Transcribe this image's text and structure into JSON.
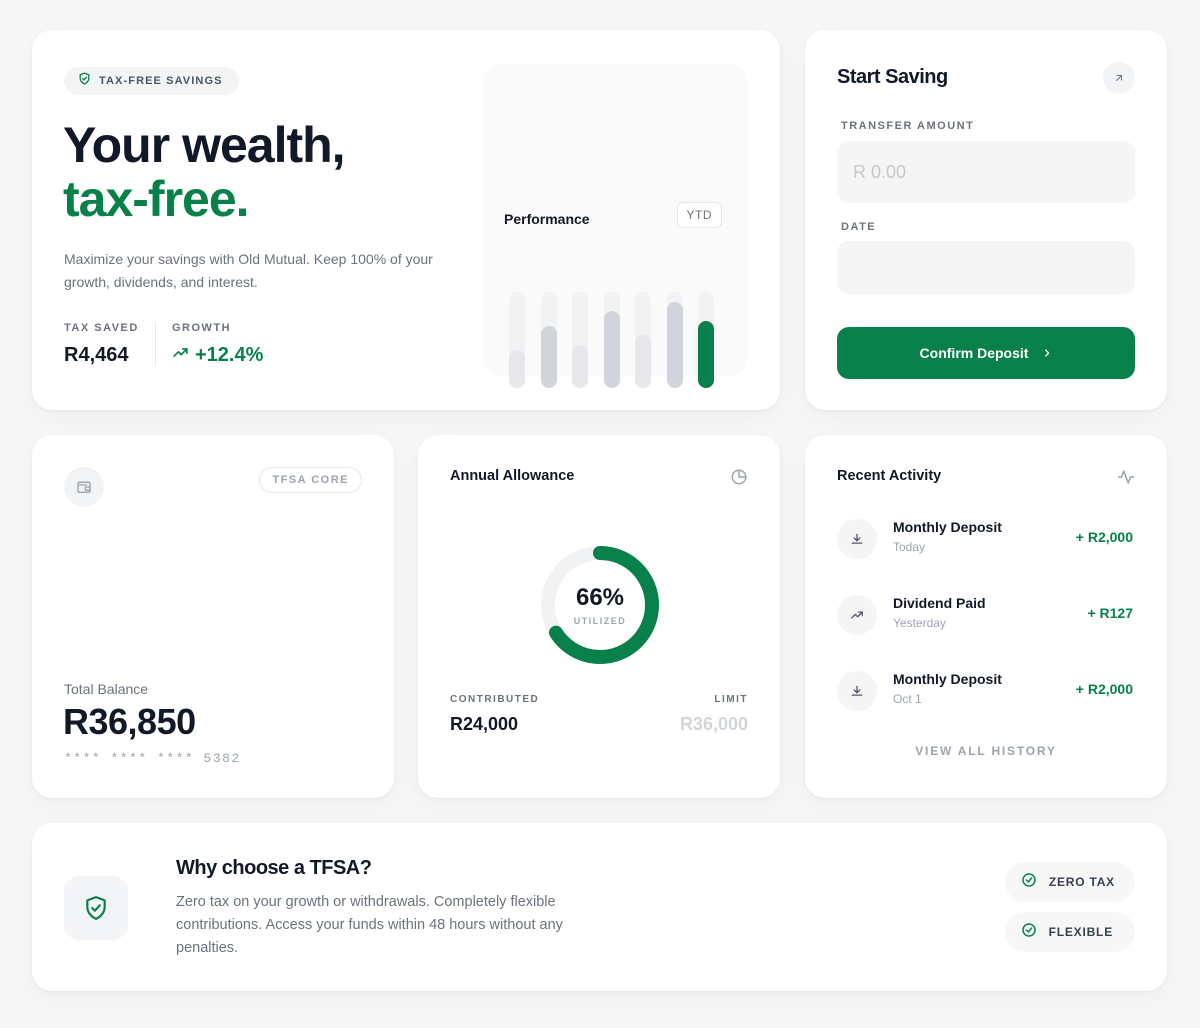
{
  "hero": {
    "badge": "TAX-FREE SAVINGS",
    "title_line1": "Your wealth,",
    "title_line2": "tax-free.",
    "description": "Maximize your savings with Old Mutual. Keep 100% of your growth, dividends, and interest.",
    "stats": {
      "tax_saved_label": "TAX SAVED",
      "tax_saved_value": "R4,464",
      "growth_label": "GROWTH",
      "growth_value": "+12.4%"
    },
    "performance": {
      "title": "Performance",
      "period": "YTD",
      "bar_levels": [
        0.4,
        0.65,
        0.45,
        0.8,
        0.55,
        0.9,
        0.7
      ],
      "highlight_index": 6
    }
  },
  "saving": {
    "title": "Start Saving",
    "amount_label": "TRANSFER AMOUNT",
    "amount_placeholder": "R 0.00",
    "date_label": "DATE",
    "date_value": "",
    "confirm_label": "Confirm Deposit"
  },
  "balance": {
    "badge": "TFSA CORE",
    "label": "Total Balance",
    "value": "R36,850",
    "card_number": "**** **** **** 5382"
  },
  "allowance": {
    "title": "Annual Allowance",
    "percent_text": "66%",
    "percent_value": 0.66,
    "utilized_label": "UTILIZED",
    "contributed_label": "CONTRIBUTED",
    "contributed_value": "R24,000",
    "limit_label": "LIMIT",
    "limit_value": "R36,000"
  },
  "activity": {
    "title": "Recent Activity",
    "items": [
      {
        "title": "Monthly Deposit",
        "date": "Today",
        "amount": "+ R2,000",
        "icon": "download-icon"
      },
      {
        "title": "Dividend Paid",
        "date": "Yesterday",
        "amount": "+ R127",
        "icon": "trending-up-icon"
      },
      {
        "title": "Monthly Deposit",
        "date": "Oct 1",
        "amount": "+ R2,000",
        "icon": "download-icon"
      }
    ],
    "view_all": "VIEW ALL HISTORY"
  },
  "why": {
    "title": "Why choose a TFSA?",
    "description": "Zero tax on your growth or withdrawals. Completely flexible contributions. Access your funds within 48 hours without any penalties.",
    "tags": [
      "ZERO TAX",
      "FLEXIBLE"
    ]
  },
  "colors": {
    "accent": "#08804a",
    "bar_grey": "#d1d5db",
    "bar_light": "#e5e7eb"
  }
}
